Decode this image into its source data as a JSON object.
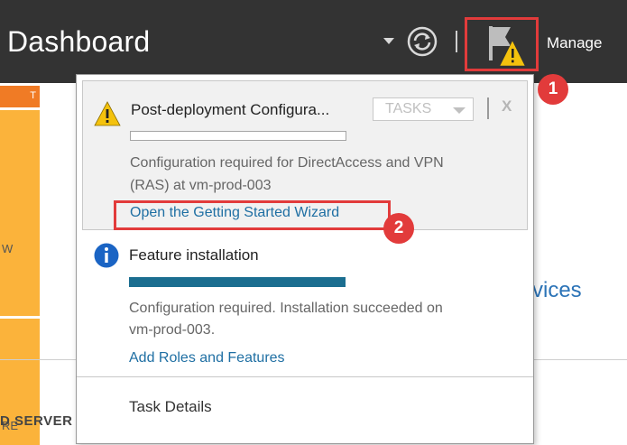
{
  "header": {
    "title": "Dashboard",
    "manage_label": "Manage",
    "icons": [
      "dropdown-arrow-icon",
      "refresh-icon",
      "notification-flag-icon",
      "warning-icon"
    ]
  },
  "background": {
    "tile_text_top": "T",
    "tile_text_w": "W",
    "tile_text_re": "RE",
    "services_text": "vices",
    "server_text": "D SERVER"
  },
  "notifications": [
    {
      "icon": "warning-icon",
      "title": "Post-deployment Configura...",
      "tasks_label": "TASKS",
      "close_label": "X",
      "progress": 0,
      "message_line1": "Configuration required for DirectAccess and VPN",
      "message_line2": "(RAS) at vm-prod-003",
      "link": "Open the Getting Started Wizard"
    },
    {
      "icon": "info-icon",
      "title": "Feature installation",
      "progress": 1.0,
      "message_line1": "Configuration required. Installation succeeded on",
      "message_line2": "vm-prod-003.",
      "link": "Add Roles and Features"
    }
  ],
  "footer": {
    "task_details": "Task Details"
  },
  "callouts": [
    "1",
    "2"
  ],
  "colors": {
    "header_bg": "#333333",
    "highlight": "#e23b3b",
    "link": "#1f6fa3",
    "progress_fill": "#1b6e90",
    "tile_orange": "#f07b25",
    "tile_yellow": "#fbb33b"
  }
}
